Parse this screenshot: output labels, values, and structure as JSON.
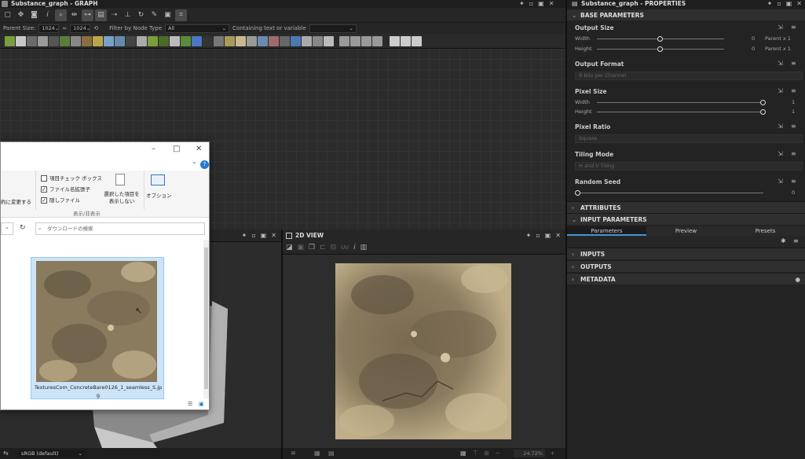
{
  "graph": {
    "title": "Substance_graph - GRAPH",
    "parent_size_label": "Parent Size:",
    "parent_size_w": "1024",
    "parent_size_h": "1024",
    "filter_label": "Filter by Node Type",
    "filter_value": "All",
    "containing_label": "Containing text or variable"
  },
  "view2d": {
    "title": "2D VIEW",
    "uv_label": "UV",
    "zoom": "24.72%"
  },
  "view3d": {
    "colorspace": "sRGB (default)"
  },
  "properties": {
    "title": "Substance_graph - PROPERTIES",
    "base_parameters": "BASE PARAMETERS",
    "output_size": {
      "label": "Output Size",
      "width_label": "Width",
      "height_label": "Height",
      "width_value": "0",
      "height_value": "0",
      "width_mode": "Parent x 1",
      "height_mode": "Parent x 1"
    },
    "output_format": {
      "label": "Output Format",
      "value": "8 Bits per Channel"
    },
    "pixel_size": {
      "label": "Pixel Size",
      "width_label": "Width",
      "height_label": "Height",
      "width_value": "1",
      "height_value": "1"
    },
    "pixel_ratio": {
      "label": "Pixel Ratio",
      "value": "Square"
    },
    "tiling_mode": {
      "label": "Tiling Mode",
      "value": "H and V Tiling"
    },
    "random_seed": {
      "label": "Random Seed",
      "value": "0"
    },
    "attributes": "ATTRIBUTES",
    "input_parameters": "INPUT PARAMETERS",
    "tabs": [
      "Parameters",
      "Preview",
      "Presets"
    ],
    "inputs": "INPUTS",
    "outputs": "OUTPUTS",
    "metadata": "METADATA"
  },
  "explorer": {
    "checkboxes": [
      {
        "label": "項目チェック ボックス",
        "checked": false
      },
      {
        "label": "ファイル名拡張子",
        "checked": true
      },
      {
        "label": "隠しファイル",
        "checked": true
      }
    ],
    "change_label": "約に変更する",
    "hide_selected": "選択した項目を\n表示しない",
    "options": "オプション",
    "group_label": "表示/非表示",
    "search_placeholder": "ダウンロードの検索",
    "file_name": "TexturesCom_ConcreteBare0126_1_seamless_S.jpg"
  },
  "colors": {
    "accent": "#4a90d9",
    "panel": "#232323",
    "section": "#2f2f2f"
  }
}
